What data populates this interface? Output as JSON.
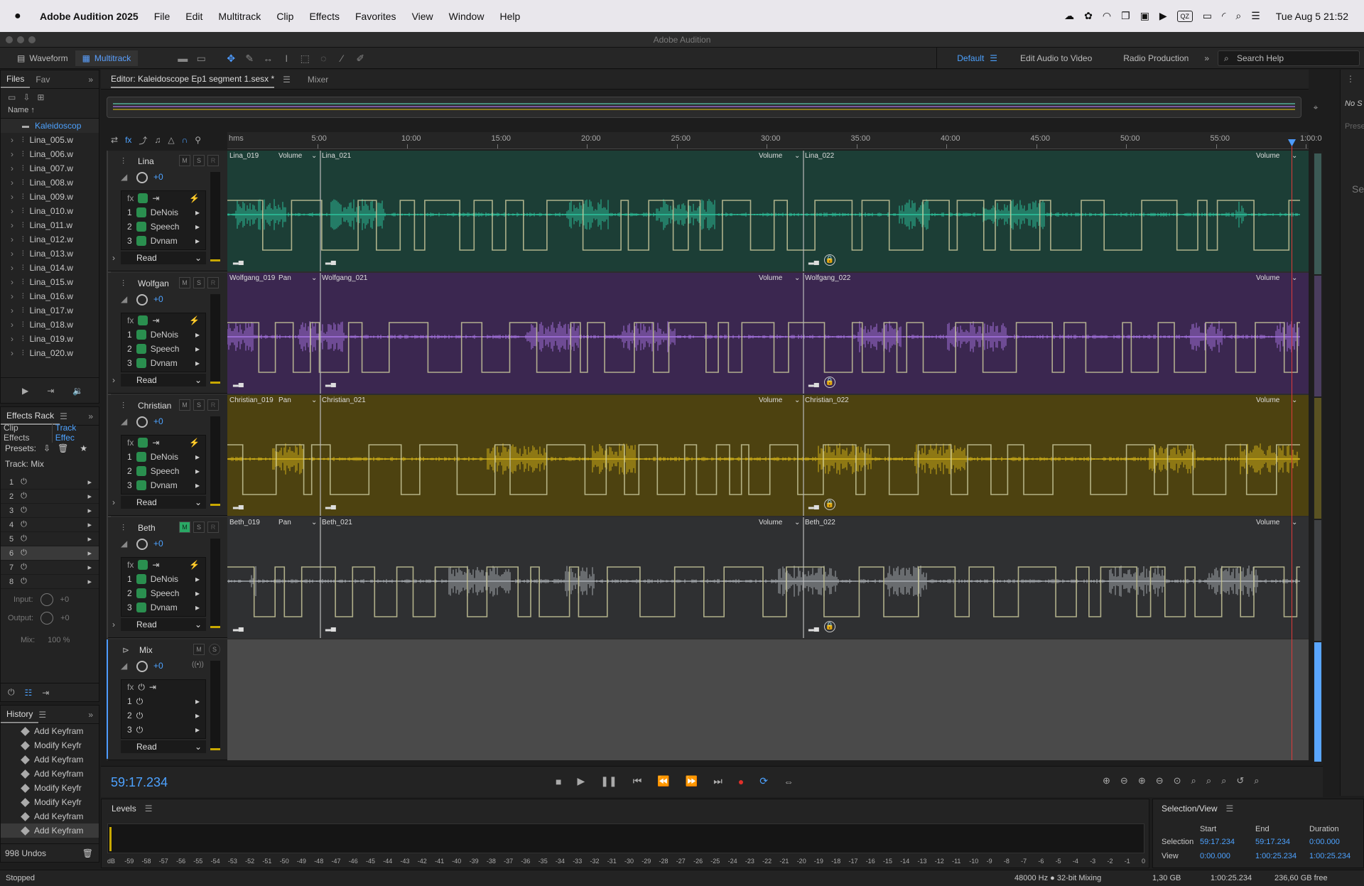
{
  "menubar": {
    "app_name": "Adobe Audition 2025",
    "items": [
      "File",
      "Edit",
      "Multitrack",
      "Clip",
      "Effects",
      "Favorites",
      "View",
      "Window",
      "Help"
    ],
    "qz_label": "QZ",
    "clock": "Tue Aug 5  21:52"
  },
  "window": {
    "title": "Adobe Audition"
  },
  "toolbar": {
    "waveform_label": "Waveform",
    "multitrack_label": "Multitrack",
    "workspaces": [
      "Default",
      "Edit Audio to Video",
      "Radio Production"
    ],
    "search_placeholder": "Search Help"
  },
  "files_panel": {
    "tabs": [
      "Files",
      "Fav"
    ],
    "column_header": "Name",
    "sort_arrow": "↑",
    "items": [
      "Kaleidoscop",
      "Lina_005.w",
      "Lina_006.w",
      "Lina_007.w",
      "Lina_008.w",
      "Lina_009.w",
      "Lina_010.w",
      "Lina_011.w",
      "Lina_012.w",
      "Lina_013.w",
      "Lina_014.w",
      "Lina_015.w",
      "Lina_016.w",
      "Lina_017.w",
      "Lina_018.w",
      "Lina_019.w",
      "Lina_020.w"
    ]
  },
  "effects_rack": {
    "title": "Effects Rack",
    "tabs": [
      "Clip Effects",
      "Track Effec"
    ],
    "presets_label": "Presets:",
    "track_label": "Track: Mix",
    "slots": [
      "1",
      "2",
      "3",
      "4",
      "5",
      "6",
      "7",
      "8"
    ],
    "input_label": "Input:",
    "input_value": "+0",
    "output_label": "Output:",
    "output_value": "+0",
    "mix_label": "Mix:",
    "mix_value": "100 %"
  },
  "history_panel": {
    "title": "History",
    "items": [
      "Add Keyfram",
      "Modify Keyfr",
      "Add Keyfram",
      "Add Keyfram",
      "Modify Keyfr",
      "Modify Keyfr",
      "Add Keyfram",
      "Add Keyfram"
    ],
    "undos": "998 Undos"
  },
  "status": {
    "text": "Stopped",
    "sample": "48000 Hz ● 32-bit Mixing",
    "mem": "1,30 GB",
    "dur": "1:00:25.234",
    "free": "236,60 GB free"
  },
  "editor": {
    "tab_label": "Editor: Kaleidoscope Ep1 segment 1.sesx *",
    "mixer_label": "Mixer",
    "ruler_unit": "hms",
    "ruler_ticks": [
      "5:00",
      "10:00",
      "15:00",
      "20:00",
      "25:00",
      "30:00",
      "35:00",
      "40:00",
      "45:00",
      "50:00",
      "55:00",
      "1:00:0"
    ],
    "time": "59:17.234"
  },
  "tracks": [
    {
      "name": "Lina",
      "volume": "+0",
      "fx": [
        "DeNois",
        "Speech",
        "Dvnam"
      ],
      "mode": "Read",
      "color": "#1c3e36",
      "wave": "#2fd1a8",
      "clips": [
        "Lina_019",
        "Lina_021",
        "Lina_022"
      ],
      "clip1_param": "Volume",
      "mute": "M",
      "solo": "S",
      "rec": "R"
    },
    {
      "name": "Wolfgan",
      "volume": "+0",
      "fx": [
        "DeNois",
        "Speech",
        "Dvnam"
      ],
      "mode": "Read",
      "color": "#3b2750",
      "wave": "#b27cf2",
      "clips": [
        "Wolfgang_019",
        "Wolfgang_021",
        "Wolfgang_022"
      ],
      "clip1_param": "Pan",
      "mute": "M",
      "solo": "S",
      "rec": "R"
    },
    {
      "name": "Christian",
      "volume": "+0",
      "fx": [
        "DeNois",
        "Speech",
        "Dvnam"
      ],
      "mode": "Read",
      "color": "#4d4210",
      "wave": "#e6c21a",
      "clips": [
        "Christian_019",
        "Christian_021",
        "Christian_022"
      ],
      "clip1_param": "Pan",
      "mute": "M",
      "solo": "S",
      "rec": "R"
    },
    {
      "name": "Beth",
      "volume": "+0",
      "fx": [
        "DeNois",
        "Speech",
        "Dvnam"
      ],
      "mode": "Read",
      "color": "#2f3032",
      "wave": "#b8bcc2",
      "clips": [
        "Beth_019",
        "Beth_021",
        "Beth_022"
      ],
      "clip1_param": "Pan",
      "mute": "M",
      "solo": "S",
      "rec": "R"
    }
  ],
  "mix_track": {
    "name": "Mix",
    "volume": "+0",
    "slots": [
      "1",
      "2",
      "3"
    ],
    "mode": "Read",
    "mute": "M",
    "solo": "S"
  },
  "clip_volume_label": "Volume",
  "levels": {
    "title": "Levels",
    "scale": [
      "dB",
      "-59",
      "-58",
      "-57",
      "-56",
      "-55",
      "-54",
      "-53",
      "-52",
      "-51",
      "-50",
      "-49",
      "-48",
      "-47",
      "-46",
      "-45",
      "-44",
      "-43",
      "-42",
      "-41",
      "-40",
      "-39",
      "-38",
      "-37",
      "-36",
      "-35",
      "-34",
      "-33",
      "-32",
      "-31",
      "-30",
      "-29",
      "-28",
      "-27",
      "-26",
      "-25",
      "-24",
      "-23",
      "-22",
      "-21",
      "-20",
      "-19",
      "-18",
      "-17",
      "-16",
      "-15",
      "-14",
      "-13",
      "-12",
      "-11",
      "-10",
      "-9",
      "-8",
      "-7",
      "-6",
      "-5",
      "-4",
      "-3",
      "-2",
      "-1",
      "0"
    ]
  },
  "selection_view": {
    "title": "Selection/View",
    "col_start": "Start",
    "col_end": "End",
    "col_duration": "Duration",
    "selection_label": "Selection",
    "selection_start": "59:17.234",
    "selection_end": "59:17.234",
    "selection_duration": "0:00.000",
    "view_label": "View",
    "view_start": "0:00.000",
    "view_end": "1:00:25.234",
    "view_duration": "1:00:25.234"
  },
  "right_panel": {
    "text1": "No S",
    "text2": "Prese",
    "text3": "Se"
  }
}
